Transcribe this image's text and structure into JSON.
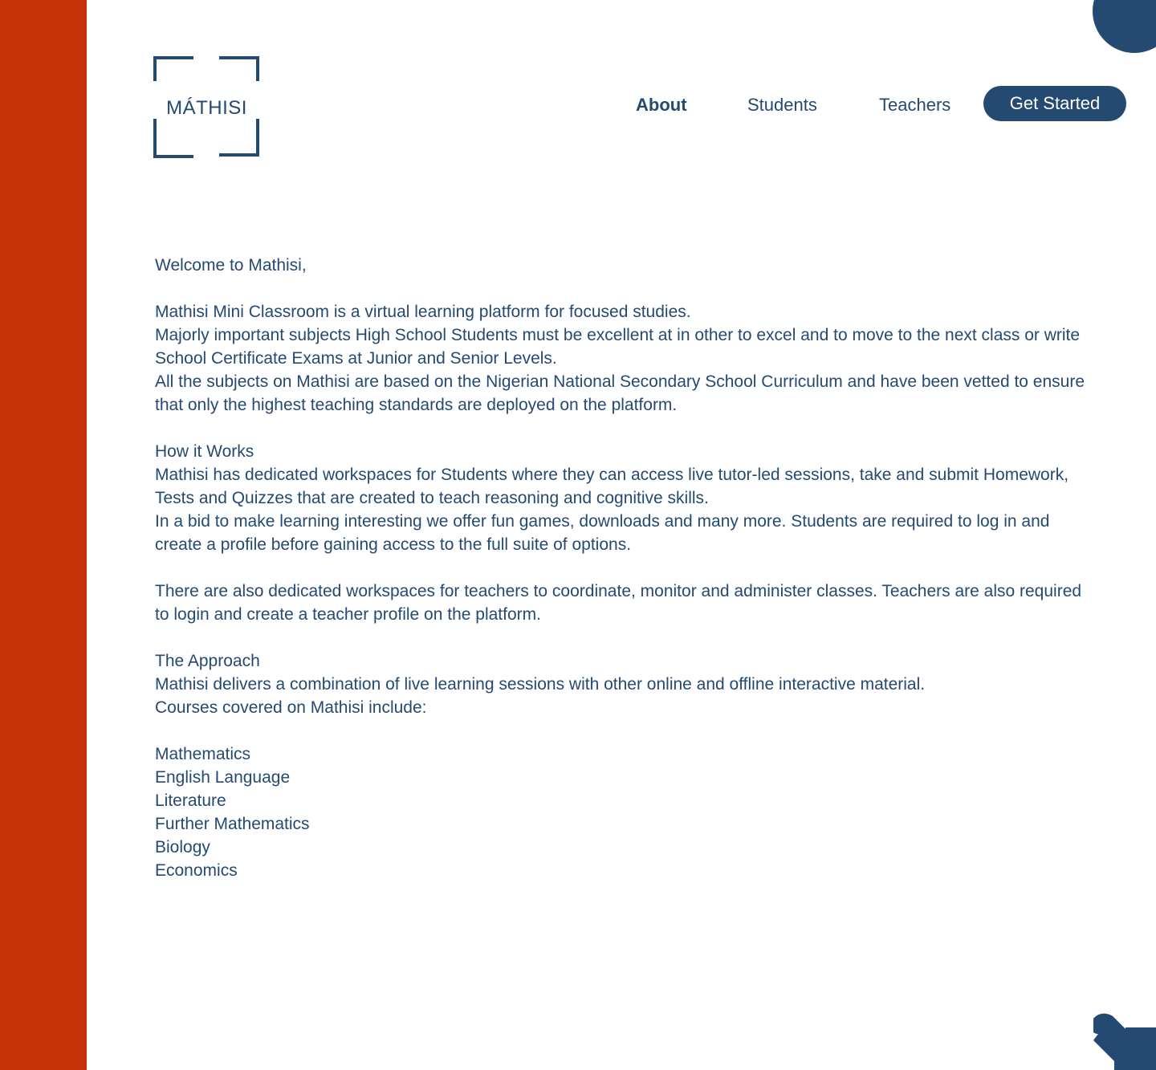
{
  "brand": {
    "logo_text": "MÁTHISI"
  },
  "nav": {
    "items": [
      {
        "label": "About"
      },
      {
        "label": "Students"
      },
      {
        "label": "Teachers"
      }
    ],
    "cta_label": "Get Started"
  },
  "content": {
    "welcome": "Welcome to Mathisi,",
    "intro": [
      "Mathisi Mini Classroom is a virtual learning platform for focused studies.",
      "Majorly important subjects High School Students must be excellent at in other to excel and   to move to the next class or write School Certificate Exams at Junior and Senior Levels.",
      "All the subjects on Mathisi are based on the Nigerian National Secondary School Curriculum and have been vetted to ensure that only the highest teaching standards are deployed on the platform."
    ],
    "how_title": "How it Works",
    "how": [
      "Mathisi has dedicated workspaces for Students where they can access live tutor-led sessions, take and submit Homework, Tests and Quizzes that are created to teach reasoning and cognitive skills.",
      "In a bid to make learning interesting we offer fun games, downloads and many more. Students are required to log in and create a profile before gaining access to the full suite of options."
    ],
    "teachers": "There are also dedicated workspaces for teachers to coordinate, monitor and administer classes. Teachers are also required to login and create a teacher profile on the platform.",
    "approach_title": "The Approach",
    "approach": [
      "Mathisi delivers a combination of live learning sessions with other online and offline interactive material.",
      "Courses covered on Mathisi include:"
    ],
    "courses": [
      "Mathematics",
      "English Language",
      "Literature",
      "Further Mathematics",
      "Biology",
      "Economics"
    ]
  },
  "colors": {
    "primary": "#244a72",
    "accent": "#c53207",
    "background": "#ffffff"
  },
  "icons": {
    "logo_frame": "corner-brackets-icon",
    "corner": "chevron-down-right-icon"
  }
}
